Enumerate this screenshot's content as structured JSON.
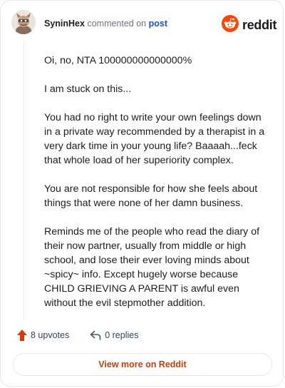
{
  "header": {
    "author": "SyninHex",
    "action_text": "commented on",
    "post_link": "post",
    "logo_text": "reddit"
  },
  "comment": {
    "paragraphs": [
      "Oi, no, NTA 100000000000000%",
      "I am stuck on this...",
      "You had no right to write your own feelings down in a private way recommended by a therapist in a very dark time in your young life? Baaaah...feck that whole load of her superiority complex.",
      "You are not responsible for how she feels about things that were none of her damn business.",
      "Reminds me of the people who read the diary of their now partner, usually from middle or high school, and lose their ever loving minds about ~spicy~ info. Except hugely worse because CHILD GRIEVING A PARENT is awful even without the evil stepmother addition."
    ]
  },
  "actions": {
    "upvotes": "8 upvotes",
    "replies": "0 replies"
  },
  "footer": {
    "view_more": "View more on Reddit"
  },
  "icons": {
    "upvote": "upvote-arrow-icon",
    "reply": "reply-arrow-icon",
    "logo": "reddit-snoo-icon",
    "avatar": "user-avatar"
  },
  "colors": {
    "reddit_orange": "#ff4500",
    "upvote": "#d93a00",
    "link_blue": "#1d4ed8",
    "view_more_text": "#c2410c"
  }
}
